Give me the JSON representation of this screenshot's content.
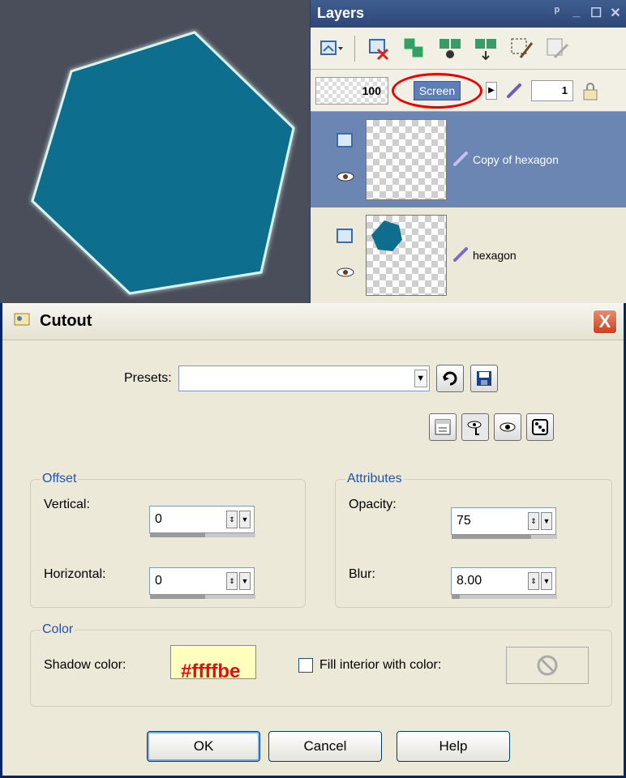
{
  "canvas": {
    "shape": "hexagon",
    "fill_color": "#0e6e8e",
    "glow_color": "#ffffbe",
    "background_color": "#4a4e5a"
  },
  "layers_panel": {
    "title": "Layers",
    "opacity": "100",
    "blend_mode": "Screen",
    "layer_count_value": "1",
    "layers": [
      {
        "name": "Copy of hexagon",
        "selected": true
      },
      {
        "name": "hexagon",
        "selected": false
      }
    ],
    "annotation_color": "#e00000"
  },
  "dialog": {
    "title": "Cutout",
    "close_label": "X",
    "presets": {
      "label": "Presets:",
      "value": ""
    },
    "offset": {
      "legend": "Offset",
      "vertical": {
        "label": "Vertical:",
        "value": "0"
      },
      "horizontal": {
        "label": "Horizontal:",
        "value": "0"
      }
    },
    "attributes": {
      "legend": "Attributes",
      "opacity": {
        "label": "Opacity:",
        "value": "75"
      },
      "blur": {
        "label": "Blur:",
        "value": "8.00"
      }
    },
    "color": {
      "legend": "Color",
      "shadow_color_label": "Shadow color:",
      "shadow_color_value": "#ffffbe",
      "hex_annotation": "#ffffbe",
      "fill_interior_label": "Fill interior with color:",
      "fill_interior_checked": false
    },
    "buttons": {
      "ok": "OK",
      "cancel": "Cancel",
      "help": "Help"
    }
  }
}
